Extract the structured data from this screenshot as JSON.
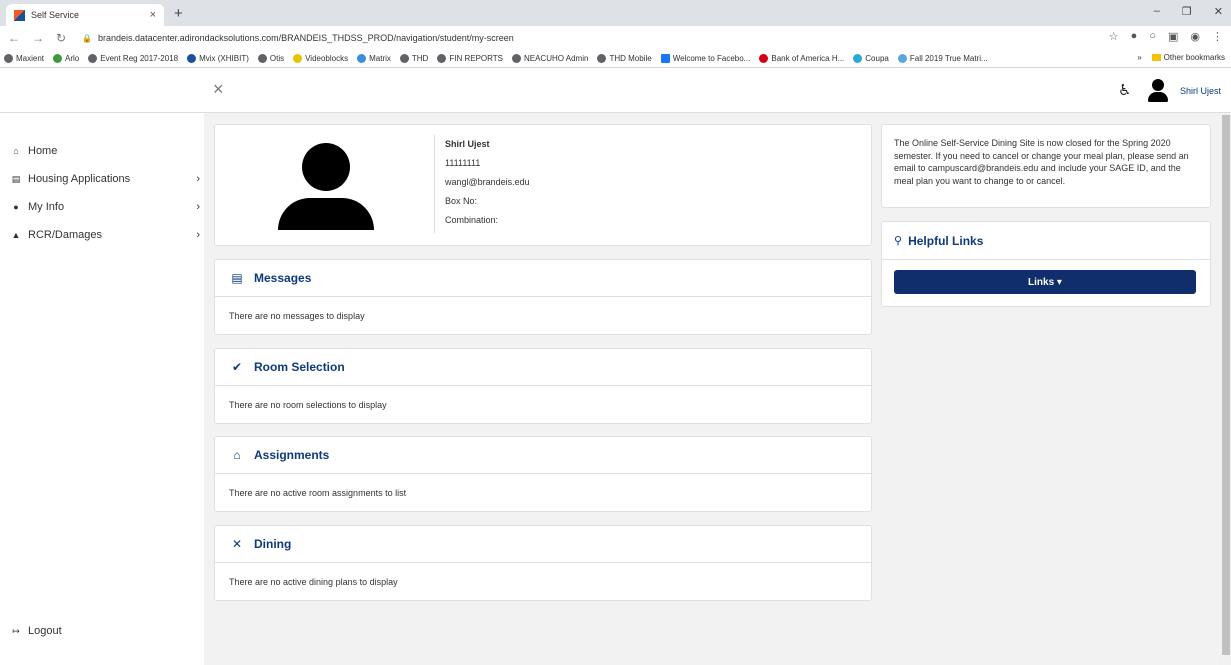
{
  "browser": {
    "tab_title": "Self Service",
    "tab_close": "×",
    "new_tab": "+",
    "window_controls": [
      "–",
      "❐",
      "✕"
    ],
    "url": "brandeis.datacenter.adirondacksolutions.com/BRANDEIS_THDSS_PROD/navigation/student/my-screen",
    "bookmarks": [
      "Maxient",
      "Arlo",
      "Event Reg 2017-2018",
      "Mvix (XHIBIT)",
      "Otis",
      "Videoblocks",
      "Matrix",
      "THD",
      "FIN REPORTS",
      "NEACUHO Admin",
      "THD Mobile",
      "Welcome to Facebo...",
      "Bank of America H...",
      "Coupa",
      "Fall 2019 True Matri..."
    ],
    "bookmarks_overflow": "»",
    "other_bookmarks": "Other bookmarks"
  },
  "header": {
    "close_glyph": "×",
    "accessibility_glyph": "♿",
    "user_name": "Shirl Ujest"
  },
  "sidebar": {
    "items": [
      {
        "label": "Home",
        "icon": "home-icon",
        "glyph": "⌂",
        "has_chevron": false
      },
      {
        "label": "Housing Applications",
        "icon": "form-icon",
        "glyph": "▤",
        "has_chevron": true
      },
      {
        "label": "My Info",
        "icon": "user-icon",
        "glyph": "●",
        "has_chevron": true
      },
      {
        "label": "RCR/Damages",
        "icon": "warning-icon",
        "glyph": "▲",
        "has_chevron": true
      }
    ],
    "chevron": "›",
    "logout": {
      "label": "Logout",
      "glyph": "↦",
      "icon": "logout-icon"
    }
  },
  "profile": {
    "name": "Shirl Ujest",
    "id": "11111111",
    "email": "wangl@brandeis.edu",
    "box_label": "Box No:",
    "combination_label": "Combination:"
  },
  "sections": {
    "messages": {
      "title": "Messages",
      "glyph": "▤",
      "body": "There are no messages to display"
    },
    "room_selection": {
      "title": "Room Selection",
      "glyph": "✔",
      "body": "There are no room selections to display"
    },
    "assignments": {
      "title": "Assignments",
      "glyph": "⌂",
      "body": "There are no active room assignments to list"
    },
    "dining": {
      "title": "Dining",
      "glyph": "✕",
      "body": "There are no active dining plans to display"
    }
  },
  "notice": {
    "text": "The Online Self-Service Dining Site is now closed for the Spring 2020 semester. If you need to cancel or change your meal plan, please send an email to campuscard@brandeis.edu and include your SAGE ID, and the meal plan you want to change to or cancel."
  },
  "helpful_links": {
    "title": "Helpful Links",
    "glyph": "⚲",
    "button_label": "Links ▾"
  },
  "colors": {
    "brand": "#0f3a7a",
    "button": "#0f2e6b",
    "page_bg": "#f2f2f2"
  }
}
